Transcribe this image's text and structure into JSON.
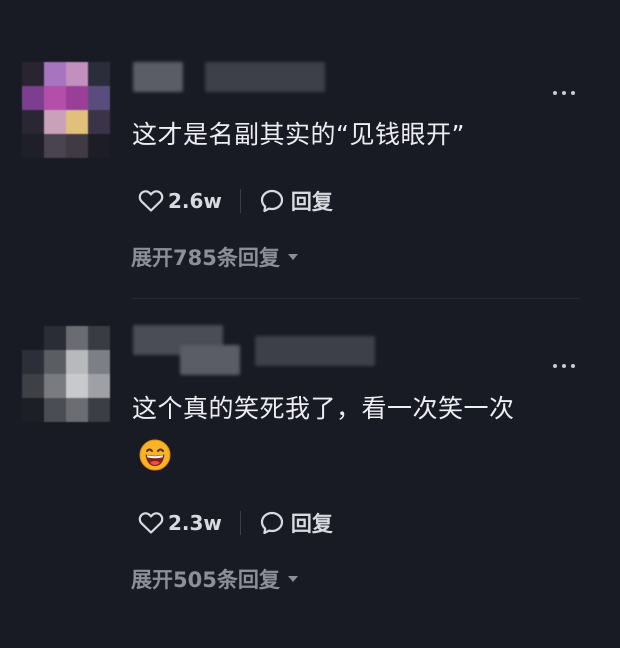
{
  "comments": [
    {
      "text": "这才是名副其实的“见钱眼开”",
      "likes": "2.6w",
      "reply_label": "回复",
      "expand_label": "展开785条回复",
      "more_icon": "more-horizontal-icon",
      "like_icon": "heart-outline-icon",
      "reply_icon": "speech-bubble-icon",
      "chevron_icon": "chevron-down-icon"
    },
    {
      "text": "这个真的笑死我了，看一次笑一次",
      "emoji": "grinning-face-emoji",
      "likes": "2.3w",
      "reply_label": "回复",
      "expand_label": "展开505条回复",
      "more_icon": "more-horizontal-icon",
      "like_icon": "heart-outline-icon",
      "reply_icon": "speech-bubble-icon",
      "chevron_icon": "chevron-down-icon"
    }
  ],
  "colors": {
    "background": "#181b24",
    "text_primary": "#ededf2",
    "text_secondary": "#8c8f9a"
  }
}
